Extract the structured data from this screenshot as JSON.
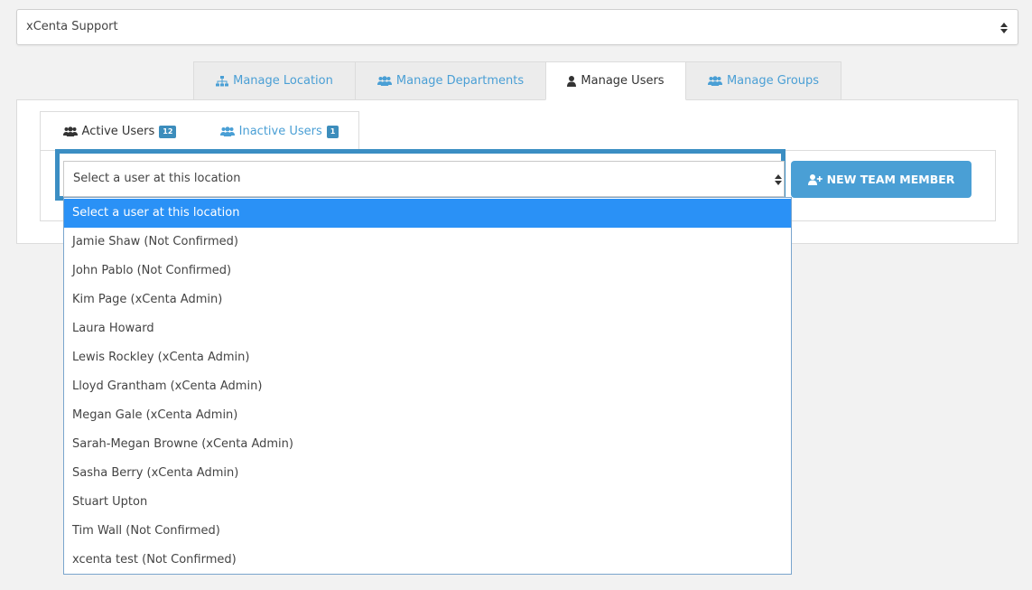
{
  "location_select": {
    "value": "xCenta Support"
  },
  "main_tabs": [
    {
      "label": "Manage Location",
      "icon": "sitemap-icon"
    },
    {
      "label": "Manage Departments",
      "icon": "users-icon"
    },
    {
      "label": "Manage Users",
      "icon": "user-icon",
      "active": true
    },
    {
      "label": "Manage Groups",
      "icon": "users-icon"
    }
  ],
  "sub_tabs": {
    "active": {
      "label": "Active Users",
      "count": "12"
    },
    "inactive": {
      "label": "Inactive Users",
      "count": "1"
    }
  },
  "user_select": {
    "value": "Select a user at this location"
  },
  "new_member_button": {
    "label": "NEW TEAM MEMBER"
  },
  "dropdown_options": [
    "Select a user at this location",
    "Jamie Shaw (Not Confirmed)",
    "John Pablo (Not Confirmed)",
    "Kim Page (xCenta Admin)",
    "Laura Howard",
    "Lewis Rockley (xCenta Admin)",
    "Lloyd Grantham (xCenta Admin)",
    "Megan Gale (xCenta Admin)",
    "Sarah-Megan Browne (xCenta Admin)",
    "Sasha Berry (xCenta Admin)",
    "Stuart Upton",
    "Tim Wall (Not Confirmed)",
    "xcenta test (Not Confirmed)"
  ],
  "colors": {
    "accent": "#4a9fd5",
    "badge": "#3c8dbc",
    "highlight": "#3b8ec3",
    "selected_option": "#2a91f6"
  }
}
